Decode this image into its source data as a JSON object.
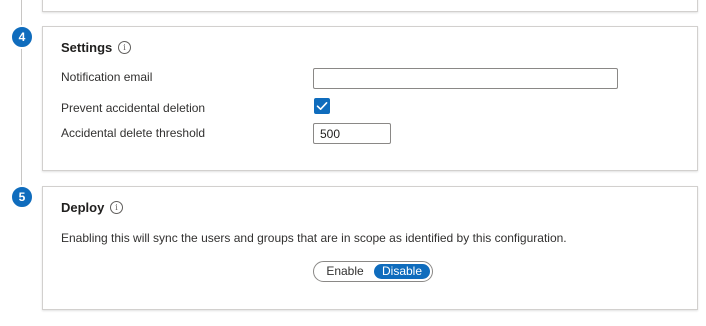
{
  "steps": [
    {
      "number": "4"
    },
    {
      "number": "5"
    }
  ],
  "settings": {
    "title": "Settings",
    "notification_email": {
      "label": "Notification email",
      "value": "",
      "placeholder": ""
    },
    "prevent_deletion": {
      "label": "Prevent accidental deletion",
      "checked": true
    },
    "delete_threshold": {
      "label": "Accidental delete threshold",
      "value": "500"
    }
  },
  "deploy": {
    "title": "Deploy",
    "description": "Enabling this will sync the users and groups that are in scope as identified by this configuration.",
    "toggle": {
      "enable_label": "Enable",
      "disable_label": "Disable",
      "selected": "Disable"
    }
  },
  "icons": {
    "info": "info-icon",
    "check": "checkmark-icon"
  },
  "colors": {
    "accent": "#0f6cbd",
    "border": "#d2d0ce"
  }
}
